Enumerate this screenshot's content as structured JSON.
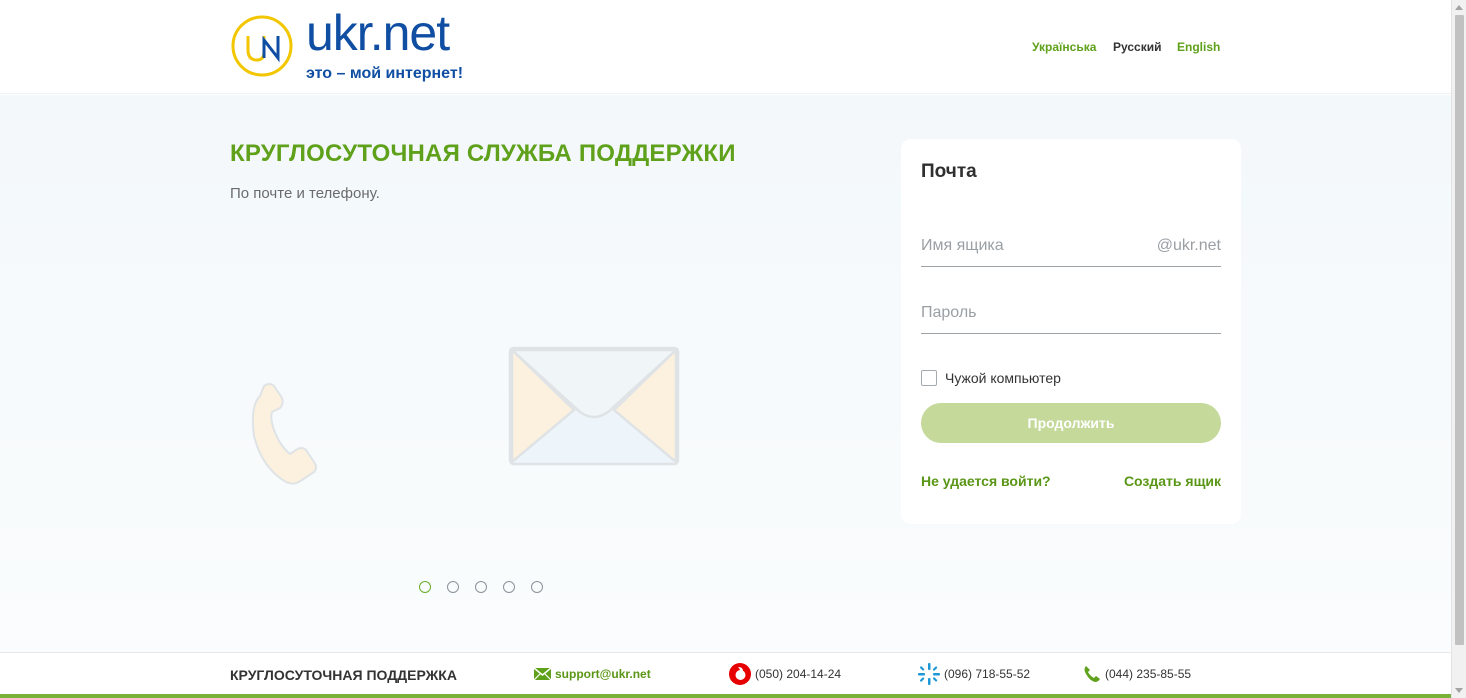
{
  "header": {
    "logo_text": "ukr.net",
    "logo_slogan": "это – мой интернет!",
    "languages": [
      {
        "label": "Українська",
        "color": "#5fa11b"
      },
      {
        "label": "Русский",
        "color": "#333333"
      },
      {
        "label": "English",
        "color": "#5fa11b"
      }
    ]
  },
  "hero": {
    "title": "КРУГЛОСУТОЧНАЯ СЛУЖБА ПОДДЕРЖКИ",
    "subtitle": "По почте и телефону.",
    "slides_count": 5,
    "active_slide": 1
  },
  "login": {
    "title": "Почта",
    "mailbox_placeholder": "Имя ящика",
    "mailbox_suffix": "@ukr.net",
    "password_placeholder": "Пароль",
    "foreign_computer_label": "Чужой компьютер",
    "continue_label": "Продолжить",
    "cant_login_label": "Не удается войти?",
    "create_mailbox_label": "Создать ящик"
  },
  "footer": {
    "title": "КРУГЛОСУТОЧНАЯ ПОДДЕРЖКА",
    "email": "support@ukr.net",
    "phone_vodafone": "(050) 204-14-24",
    "phone_kyivstar": "(096) 718-55-52",
    "phone_landline": "(044) 235-85-55"
  },
  "colors": {
    "accent": "#5fa11b",
    "brand_blue": "#0f4ea2",
    "button_disabled": "#c4d99a"
  }
}
